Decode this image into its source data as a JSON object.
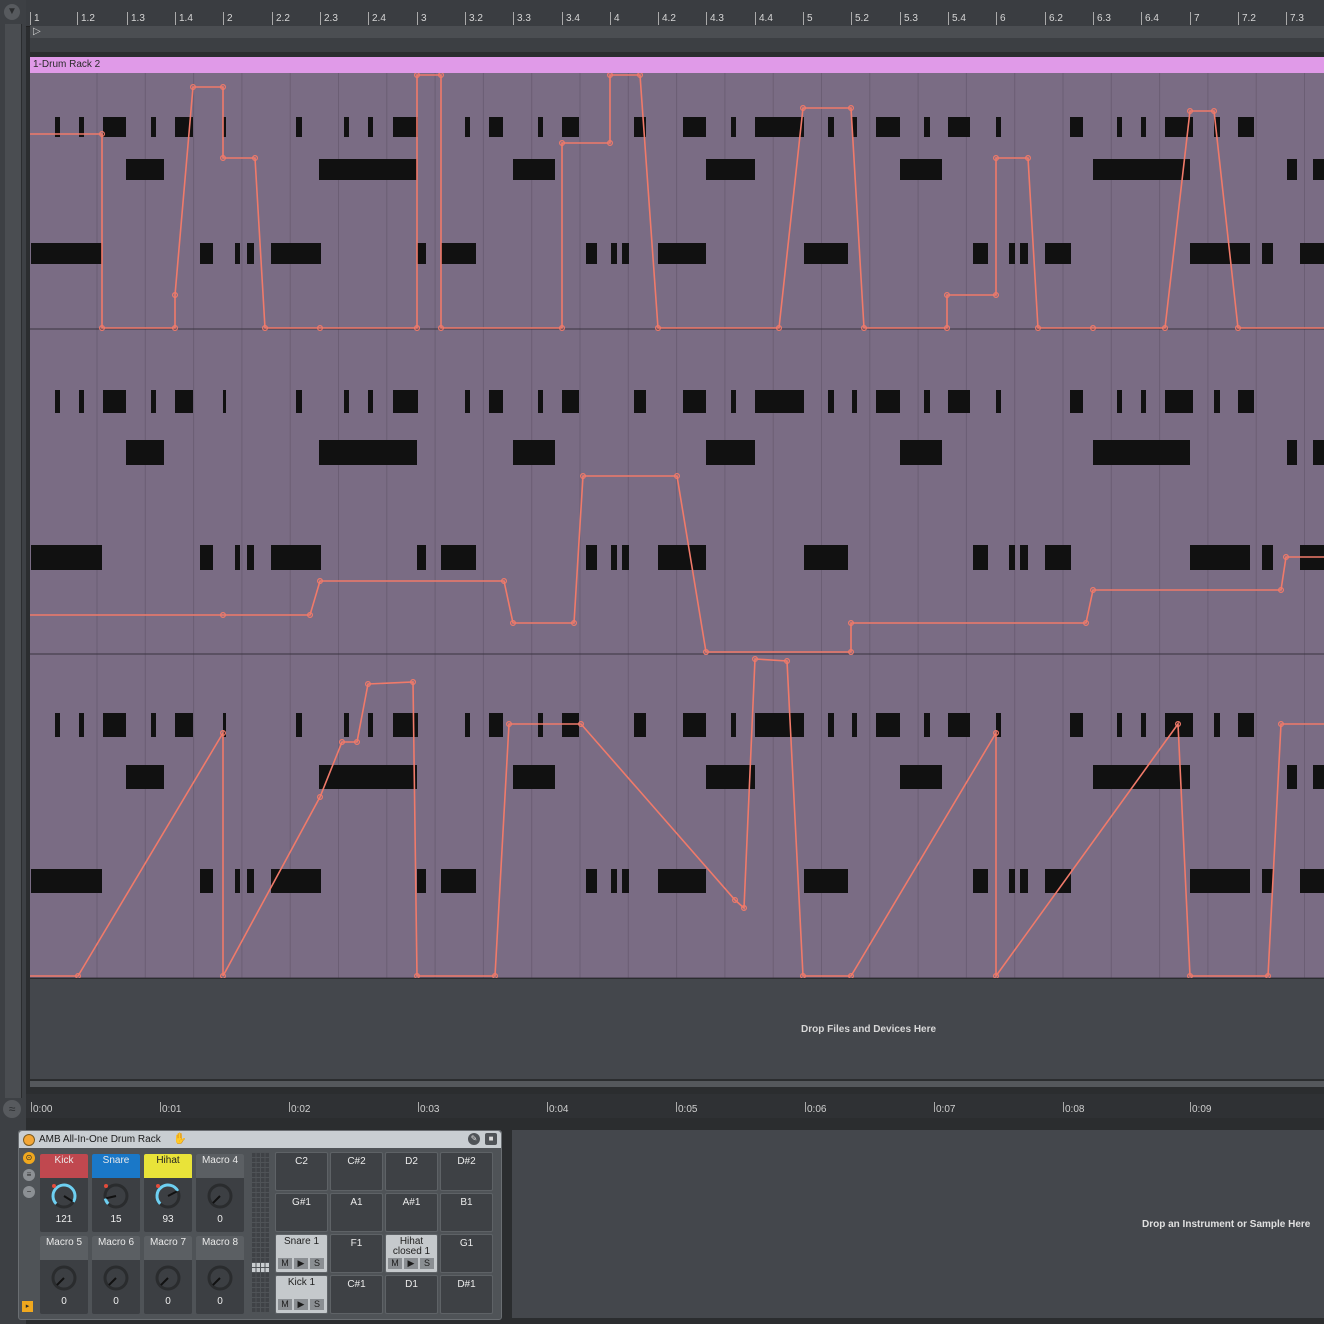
{
  "ruler": {
    "labels": [
      "1",
      "1.2",
      "1.3",
      "1.4",
      "2",
      "2.2",
      "2.3",
      "2.4",
      "3",
      "3.2",
      "3.3",
      "3.4",
      "4",
      "4.2",
      "4.3",
      "4.4",
      "5",
      "5.2",
      "5.3",
      "5.4",
      "6",
      "6.2",
      "6.3",
      "6.4",
      "7",
      "7.2",
      "7.3"
    ]
  },
  "clip": {
    "title": "1-Drum Rack 2",
    "color": "#e09ae8",
    "drop_text": "Drop Files and Devices Here"
  },
  "time_ruler": {
    "labels": [
      "0:00",
      "0:01",
      "0:02",
      "0:03",
      "0:04",
      "0:05",
      "0:06",
      "0:07",
      "0:08",
      "0:09"
    ]
  },
  "device": {
    "title": "AMB All-In-One Drum Rack",
    "macros": [
      {
        "label": "Kick",
        "value": "121",
        "color": "#c0484f",
        "active": true
      },
      {
        "label": "Snare",
        "value": "15",
        "color": "#1a78c8",
        "active": true
      },
      {
        "label": "Hihat",
        "value": "93",
        "color": "#e9e339",
        "active": true
      },
      {
        "label": "Macro 4",
        "value": "0",
        "color": "#5b5f63",
        "active": false
      },
      {
        "label": "Macro 5",
        "value": "0",
        "color": "#5b5f63",
        "active": false
      },
      {
        "label": "Macro 6",
        "value": "0",
        "color": "#5b5f63",
        "active": false
      },
      {
        "label": "Macro 7",
        "value": "0",
        "color": "#5b5f63",
        "active": false
      },
      {
        "label": "Macro 8",
        "value": "0",
        "color": "#5b5f63",
        "active": false
      }
    ],
    "pads": [
      {
        "note": "C2"
      },
      {
        "note": "C#2"
      },
      {
        "note": "D2"
      },
      {
        "note": "D#2"
      },
      {
        "note": "G#1"
      },
      {
        "note": "A1"
      },
      {
        "note": "A#1"
      },
      {
        "note": "B1"
      },
      {
        "note": "Snare 1",
        "filled": true
      },
      {
        "note": "F1"
      },
      {
        "note": "Hihat closed 1",
        "filled": true
      },
      {
        "note": "G1"
      },
      {
        "note": "Kick 1",
        "filled": true
      },
      {
        "note": "C#1"
      },
      {
        "note": "D1"
      },
      {
        "note": "D#1"
      }
    ],
    "pad_buttons": {
      "mute": "M",
      "play": "▶",
      "solo": "S"
    }
  },
  "instrument_drop": {
    "text": "Drop an Instrument or Sample Here"
  },
  "icons": {
    "top_arrow": "chevron-down-icon",
    "power": "power-icon",
    "hand": "hand-icon",
    "edit": "edit-icon",
    "save": "save-icon"
  },
  "colors": {
    "automation": "#f07a6a",
    "clip_bg": "#7a6c84",
    "notes": "#111111"
  }
}
